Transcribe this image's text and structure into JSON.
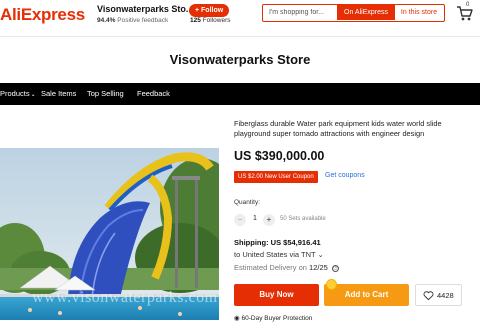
{
  "brand": {
    "logo": "AliExpress",
    "color": "#e62e04"
  },
  "store": {
    "name_short": "Visonwaterparks Sto...",
    "feedback_pct": "94.4%",
    "feedback_label": "Positive feedback",
    "follow_label": "+ Follow",
    "followers_count": "125",
    "followers_label": "Followers",
    "title": "Visonwaterparks Store"
  },
  "search": {
    "placeholder": "I'm shopping for...",
    "on_aliexpress": "On AliExpress",
    "in_store": "In this store"
  },
  "cart": {
    "icon": "cart-icon",
    "count": "0"
  },
  "nav": {
    "items": [
      {
        "label": "Products",
        "has_dropdown": true
      },
      {
        "label": "Sale Items"
      },
      {
        "label": "Top Selling"
      },
      {
        "label": "Feedback"
      }
    ]
  },
  "product": {
    "title": "Fiberglass durable Water park equipment kids water world slide playground super tornado attractions with engineer design",
    "price": "US $390,000.00",
    "coupon_badge": "US $2.00 New User Coupon",
    "get_coupons": "Get coupons",
    "quantity_label": "Quantity:",
    "quantity_value": "1",
    "minus": "−",
    "plus": "+",
    "available": "50 Sets available",
    "shipping_label": "Shipping: US $54,916.41",
    "ship_to": "to United States via TNT ⌄",
    "est_label": "Estimated Delivery on",
    "est_date": "12/25",
    "buy_now": "Buy Now",
    "add_to_cart": "Add to Cart",
    "wish_count": "4428",
    "protection": "60-Day Buyer Protection"
  },
  "image": {
    "watermark": "www.visonwaterparks.com"
  },
  "colors": {
    "accent": "#e62e04",
    "orange": "#f59a12",
    "link": "#2a6fd6"
  }
}
